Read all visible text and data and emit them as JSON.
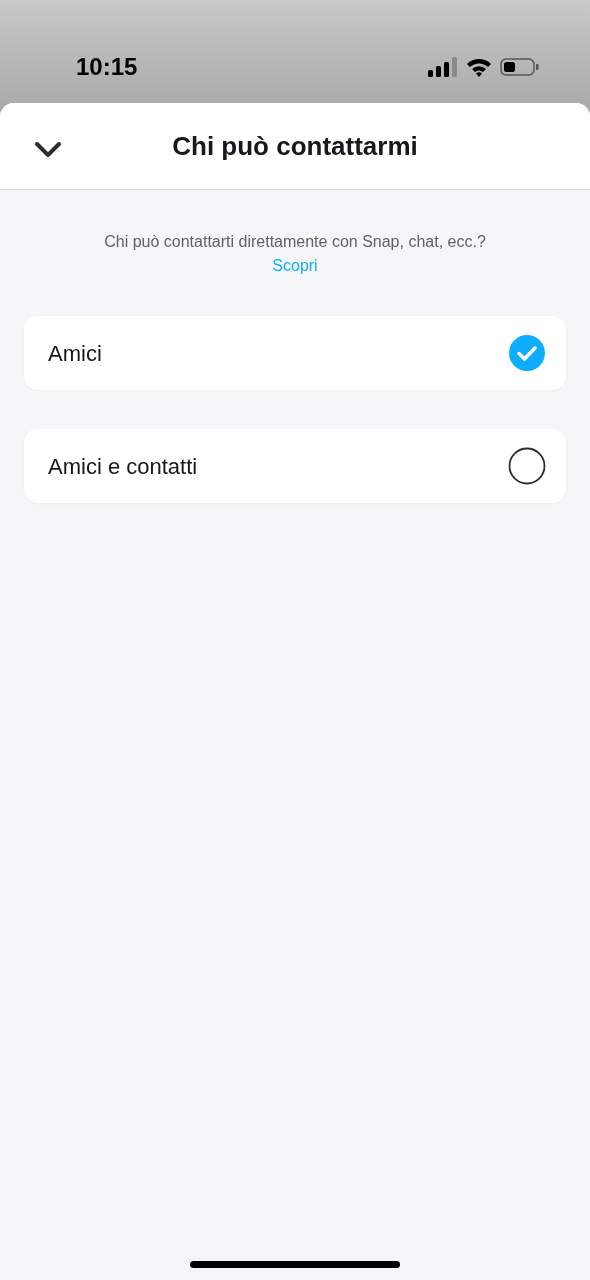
{
  "status_bar": {
    "time": "10:15"
  },
  "header": {
    "title": "Chi può contattarmi"
  },
  "description": {
    "text": "Chi può contattarti direttamente con Snap, chat, ecc.?",
    "link": "Scopri"
  },
  "options": [
    {
      "label": "Amici",
      "selected": true
    },
    {
      "label": "Amici e contatti",
      "selected": false
    }
  ]
}
